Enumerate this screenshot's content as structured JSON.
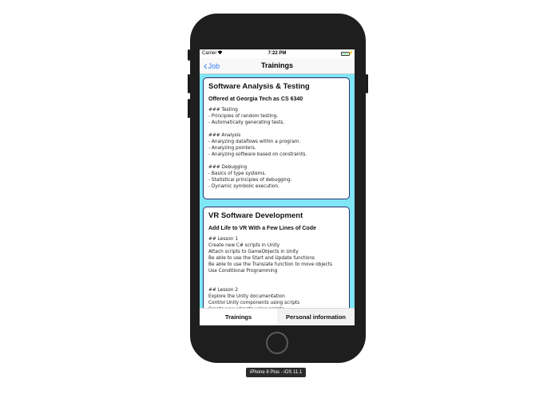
{
  "status_bar": {
    "carrier": "Carrier",
    "wifi_icon": "wifi-icon",
    "time": "7:22 PM",
    "battery_icon": "battery-icon",
    "battery_level": 1.0
  },
  "nav": {
    "back_label": "Job",
    "title": "Trainings",
    "back_icon": "chevron-left-icon"
  },
  "trainings": [
    {
      "title": "Software Analysis & Testing",
      "subtitle": "Offered at Georgia Tech as CS 6340",
      "body": "### Testing\n- Principles of random testing.\n- Automatically generating tests.\n\n### Analysis\n- Analyzing dataflows within a program.\n- Analyzing pointers.\n- Analyzing software based on constraints.\n\n### Debugging\n- Basics of type systems.\n- Statistical principles of debugging.\n- Dynamic symbolic execution."
    },
    {
      "title": "VR Software Development",
      "subtitle": "Add Life to VR With a Few Lines of Code",
      "body": "## Lesson 1\nCreate new C# scripts in Unity\nAttach scripts to GameObjects in Unity\nBe able to use the Start and Update functions\nBe able to use the Translate function to move objects\nUse Conditional Programming\n\n\n## Lesson 2\nExplore the Unity documentation\nControl Unity components using scripts\nCreate new objects using scripts"
    }
  ],
  "tabs": [
    {
      "label": "Trainings",
      "active": false
    },
    {
      "label": "Personal information",
      "active": true
    }
  ],
  "device_label": "iPhone 8 Plus - iOS 11.1",
  "colors": {
    "content_bg": "#7fe6f6",
    "accent": "#2f7cf6",
    "card_border": "#2a2f6e"
  }
}
